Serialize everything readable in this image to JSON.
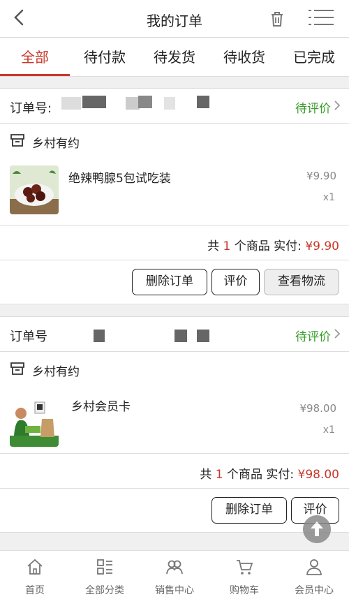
{
  "header": {
    "title": "我的订单",
    "back_icon": "chevron-left-icon",
    "trash_icon": "trash-icon",
    "menu_icon": "list-menu-icon"
  },
  "tabs": [
    {
      "label": "全部",
      "active": true
    },
    {
      "label": "待付款",
      "active": false
    },
    {
      "label": "待发货",
      "active": false
    },
    {
      "label": "待收货",
      "active": false
    },
    {
      "label": "已完成",
      "active": false
    }
  ],
  "orders": [
    {
      "order_no_label": "订单号:",
      "status": "待评价",
      "shop": "乡村有约",
      "item_name": "绝辣鸭腺5包试吃装",
      "price": "¥9.90",
      "qty": "x1",
      "summary_prefix": "共",
      "summary_count": "1",
      "summary_mid": "个商品 实付:",
      "summary_total": "¥9.90",
      "buttons": [
        "删除订单",
        "评价",
        "查看物流"
      ]
    },
    {
      "order_no_label": "订单号",
      "status": "待评价",
      "shop": "乡村有约",
      "item_name": "乡村会员卡",
      "price": "¥98.00",
      "qty": "x1",
      "summary_prefix": "共",
      "summary_count": "1",
      "summary_mid": "个商品 实付:",
      "summary_total": "¥98.00",
      "buttons": [
        "删除订单",
        "评价"
      ]
    }
  ],
  "tabbar": [
    {
      "label": "首页",
      "icon": "home-icon"
    },
    {
      "label": "全部分类",
      "icon": "category-icon"
    },
    {
      "label": "销售中心",
      "icon": "sales-center-icon"
    },
    {
      "label": "购物车",
      "icon": "cart-icon"
    },
    {
      "label": "会员中心",
      "icon": "member-icon"
    }
  ],
  "colors": {
    "accent": "#c9382a",
    "status_green": "#3a9c2c"
  }
}
